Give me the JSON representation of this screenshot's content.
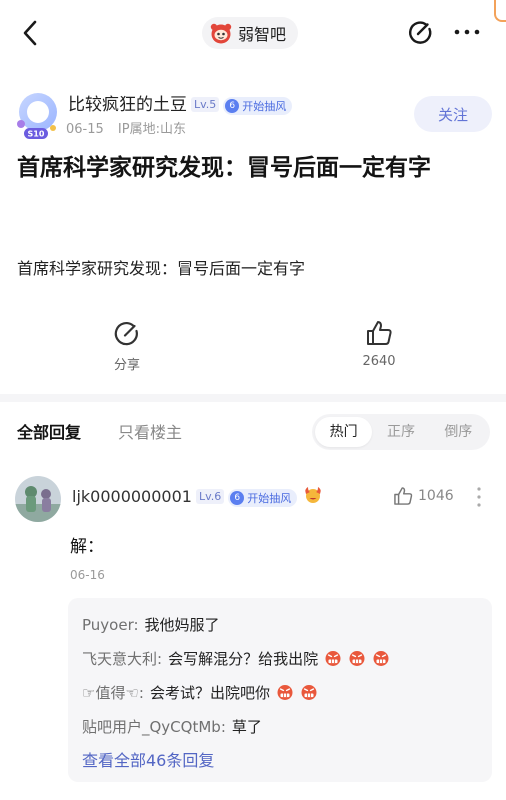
{
  "header": {
    "forum_name": "弱智吧",
    "back_icon": "chevron-left-icon",
    "edit_icon": "edit-icon",
    "more_icon": "more-horizontal-icon"
  },
  "author": {
    "name": "比较疯狂的土豆",
    "level": "Lv.5",
    "rank_number": "6",
    "rank_title": "开始抽风",
    "avatar_badge": "S10",
    "date": "06-15",
    "ip_location": "IP属地:山东",
    "follow_label": "关注"
  },
  "post": {
    "title": "首席科学家研究发现：冒号后面一定有字",
    "body": "首席科学家研究发现：冒号后面一定有字"
  },
  "actions": {
    "share_label": "分享",
    "like_count": "2640"
  },
  "tabs": {
    "all_replies": "全部回复",
    "op_only": "只看楼主",
    "sort_options": [
      "热门",
      "正序",
      "倒序"
    ],
    "active_sort": "热门"
  },
  "reply": {
    "username": "ljk0000000001",
    "level": "Lv.6",
    "rank_number": "6",
    "rank_title": "开始抽风",
    "like_count": "1046",
    "content": "解：",
    "date": "06-16",
    "sub_replies": [
      {
        "user": "Puyoer",
        "text": "我他妈服了",
        "emoji_count": 0
      },
      {
        "user": "飞天意大利",
        "text": "会写解混分？给我出院",
        "emoji_count": 3
      },
      {
        "user": "☞值得☜",
        "text": "会考试？出院吧你",
        "emoji_count": 2
      },
      {
        "user": "贴吧用户_QyCQtMb",
        "text": "草了",
        "emoji_count": 0
      }
    ],
    "view_all_label": "查看全部46条回复"
  },
  "colors": {
    "accent_blue": "#5366c4",
    "follow_bg": "#eef0fb",
    "badge_blue": "#5b7ff0",
    "orange_mark": "#f3a25a"
  }
}
